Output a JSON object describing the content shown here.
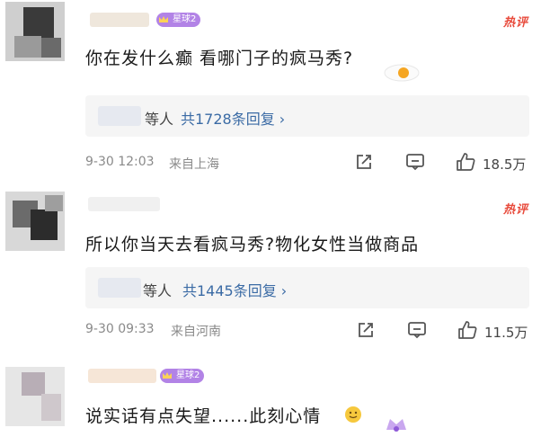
{
  "comments": [
    {
      "text": "你在发什么癫 看哪门子的疯马秀?",
      "badge": "星球2",
      "hot_label": "热评",
      "reply_who": "等人",
      "reply_count": "共1728条回复 ›",
      "time": "9-30 12:03",
      "location": "来自上海",
      "likes": "18.5万"
    },
    {
      "text": "所以你当天去看疯马秀?物化女性当做商品",
      "badge": "",
      "hot_label": "热评",
      "reply_who": "等人",
      "reply_count": "共1445条回复 ›",
      "time": "9-30 09:33",
      "location": "来自河南",
      "likes": "11.5万"
    },
    {
      "text": "说实话有点失望......此刻心情",
      "badge": "星球2",
      "hot_label": "",
      "reply_who": "",
      "reply_count": "",
      "time": "",
      "location": "",
      "likes": ""
    }
  ],
  "icons": [
    "share-icon",
    "comment-icon",
    "like-icon",
    "egg-emoji",
    "smile-emoji",
    "crown-icon"
  ],
  "colors": {
    "hot": "#e84a3b",
    "reply_link": "#3b6ba5",
    "meta": "#8a8a8a",
    "reply_bg": "#f5f5f5"
  }
}
